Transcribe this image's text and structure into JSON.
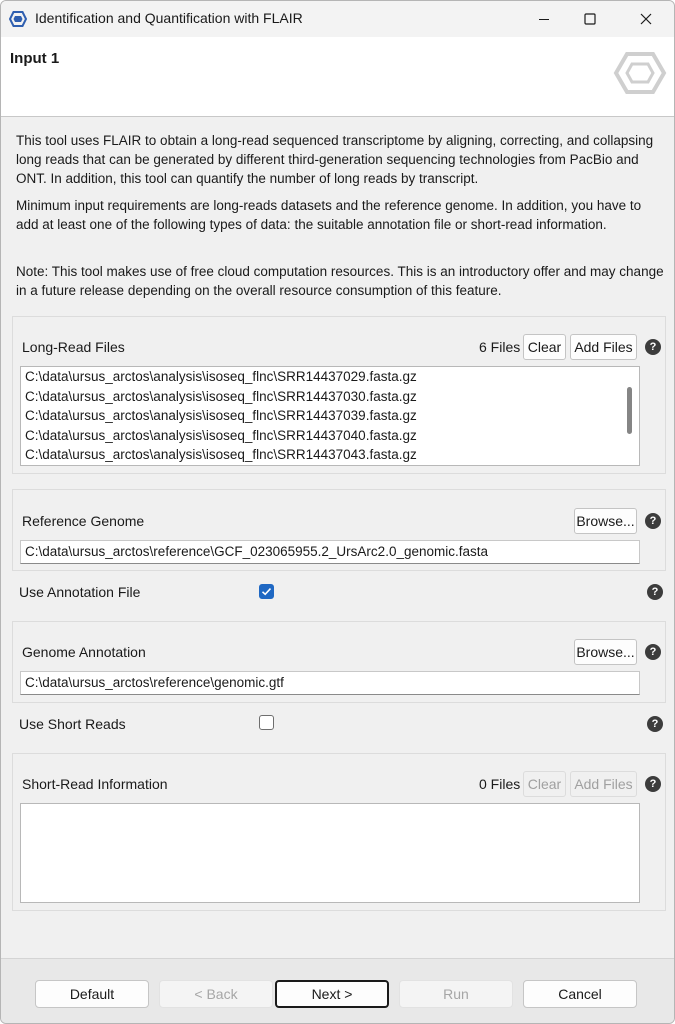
{
  "window": {
    "title": "Identification and Quantification with FLAIR"
  },
  "header": {
    "title": "Input 1"
  },
  "description": {
    "p1": "This tool uses FLAIR to obtain a long-read sequenced transcriptome by aligning, correcting, and collapsing long reads that can be generated by different third-generation sequencing technologies from PacBio and ONT. In addition, this tool can quantify the number of long reads by transcript.",
    "p2": "Minimum input requirements are long-reads datasets and the reference genome. In addition, you have to add at least one of the following types of data: the suitable annotation file or short-read information.",
    "p3": "Note: This tool makes use of free cloud computation resources. This is an introductory offer and may change in a future release depending on the overall resource consumption of this feature."
  },
  "long_read": {
    "label": "Long-Read Files",
    "count": "6 Files",
    "clear_label": "Clear",
    "add_label": "Add Files",
    "files": [
      "C:\\data\\ursus_arctos\\analysis\\isoseq_flnc\\SRR14437029.fasta.gz",
      "C:\\data\\ursus_arctos\\analysis\\isoseq_flnc\\SRR14437030.fasta.gz",
      "C:\\data\\ursus_arctos\\analysis\\isoseq_flnc\\SRR14437039.fasta.gz",
      "C:\\data\\ursus_arctos\\analysis\\isoseq_flnc\\SRR14437040.fasta.gz",
      "C:\\data\\ursus_arctos\\analysis\\isoseq_flnc\\SRR14437043.fasta.gz"
    ]
  },
  "reference": {
    "label": "Reference Genome",
    "browse_label": "Browse...",
    "value": "C:\\data\\ursus_arctos\\reference\\GCF_023065955.2_UrsArc2.0_genomic.fasta"
  },
  "use_annotation": {
    "label": "Use Annotation File",
    "checked": true
  },
  "annotation": {
    "label": "Genome Annotation",
    "browse_label": "Browse...",
    "value": "C:\\data\\ursus_arctos\\reference\\genomic.gtf"
  },
  "use_short_reads": {
    "label": "Use Short Reads",
    "checked": false
  },
  "short_read": {
    "label": "Short-Read Information",
    "count": "0 Files",
    "clear_label": "Clear",
    "add_label": "Add Files"
  },
  "help_glyph": "?",
  "footer": {
    "default_label": "Default",
    "back_label": "< Back",
    "next_label": "Next >",
    "run_label": "Run",
    "cancel_label": "Cancel"
  },
  "icons": {
    "app": "hexagon-logo-icon",
    "header_logo": "hexagon-logo-icon"
  },
  "colors": {
    "accent": "#1f68c3",
    "help_icon": "#3c3c3c"
  }
}
